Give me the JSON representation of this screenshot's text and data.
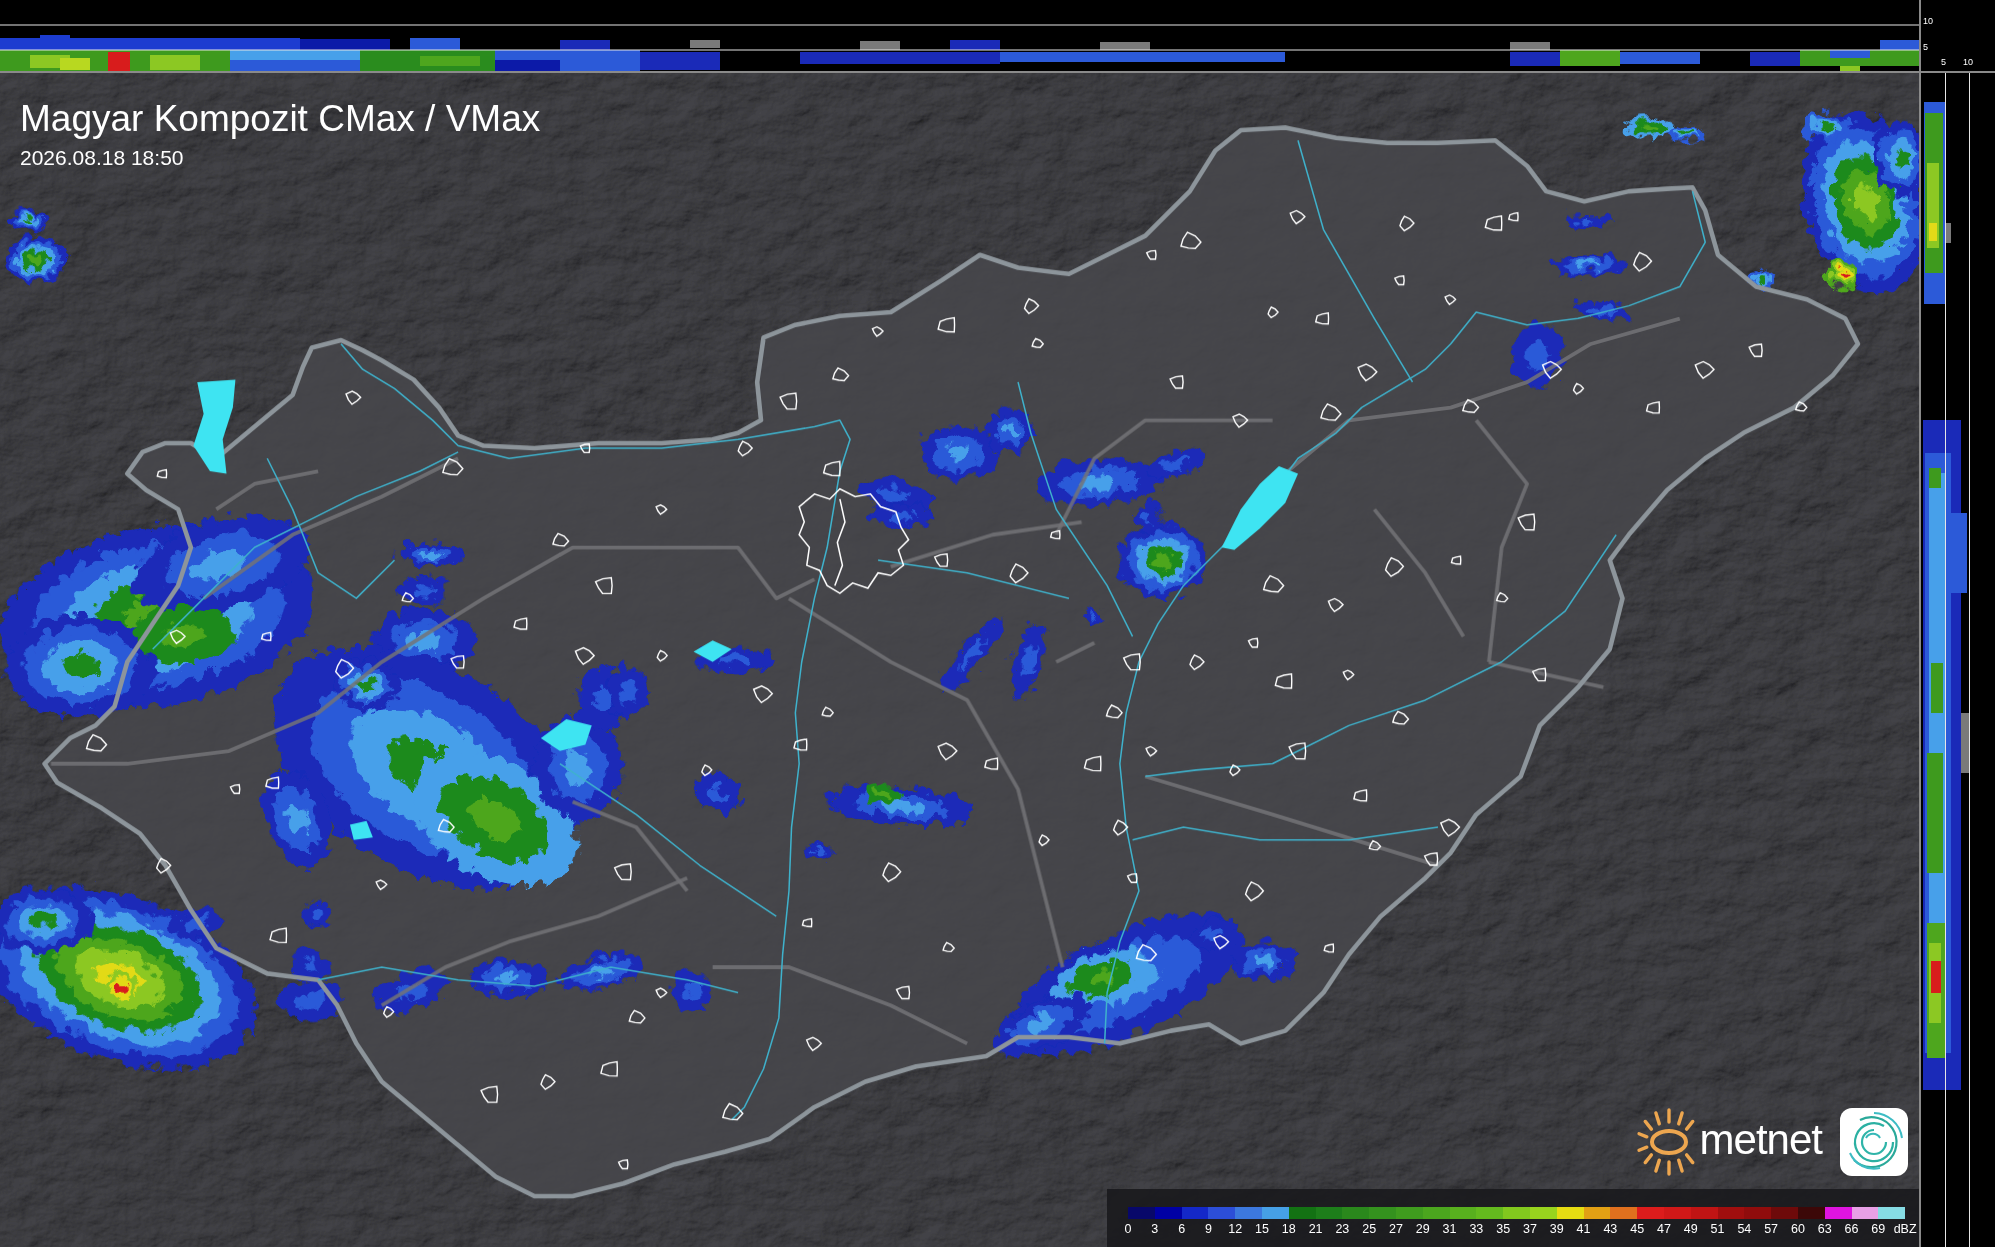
{
  "top_profile": {
    "ticks": [
      "10",
      "5"
    ]
  },
  "side_profile": {
    "ticks": [
      "5",
      "10"
    ]
  },
  "map": {
    "title": "Magyar Kompozit CMax / VMax",
    "timestamp": "2026.08.18 18:50"
  },
  "logo": {
    "text": "metnet"
  },
  "legend": {
    "steps": [
      {
        "label": "0",
        "color": "#08086a"
      },
      {
        "label": "3",
        "color": "#0000a4"
      },
      {
        "label": "6",
        "color": "#1428c8"
      },
      {
        "label": "9",
        "color": "#2c4ed8"
      },
      {
        "label": "12",
        "color": "#3c78de"
      },
      {
        "label": "15",
        "color": "#46a0e6"
      },
      {
        "label": "18",
        "color": "#137213"
      },
      {
        "label": "21",
        "color": "#1d7e1a"
      },
      {
        "label": "23",
        "color": "#2a881c"
      },
      {
        "label": "25",
        "color": "#34921e"
      },
      {
        "label": "27",
        "color": "#3f9c1e"
      },
      {
        "label": "29",
        "color": "#4ba61e"
      },
      {
        "label": "31",
        "color": "#58b01e"
      },
      {
        "label": "33",
        "color": "#64ba1e"
      },
      {
        "label": "35",
        "color": "#82c81e"
      },
      {
        "label": "37",
        "color": "#98d41e"
      },
      {
        "label": "39",
        "color": "#e6dc12"
      },
      {
        "label": "41",
        "color": "#e2a014"
      },
      {
        "label": "43",
        "color": "#e0701e"
      },
      {
        "label": "45",
        "color": "#dc1c1c"
      },
      {
        "label": "47",
        "color": "#d01818"
      },
      {
        "label": "49",
        "color": "#c01414"
      },
      {
        "label": "51",
        "color": "#a00e0e"
      },
      {
        "label": "54",
        "color": "#900c0c"
      },
      {
        "label": "57",
        "color": "#6e0a0a"
      },
      {
        "label": "60",
        "color": "#3c0808"
      },
      {
        "label": "63",
        "color": "#e014e0"
      },
      {
        "label": "66",
        "color": "#e8a0e6"
      },
      {
        "label": "69",
        "color": "#86dce4"
      }
    ],
    "unit": "dBZ"
  }
}
